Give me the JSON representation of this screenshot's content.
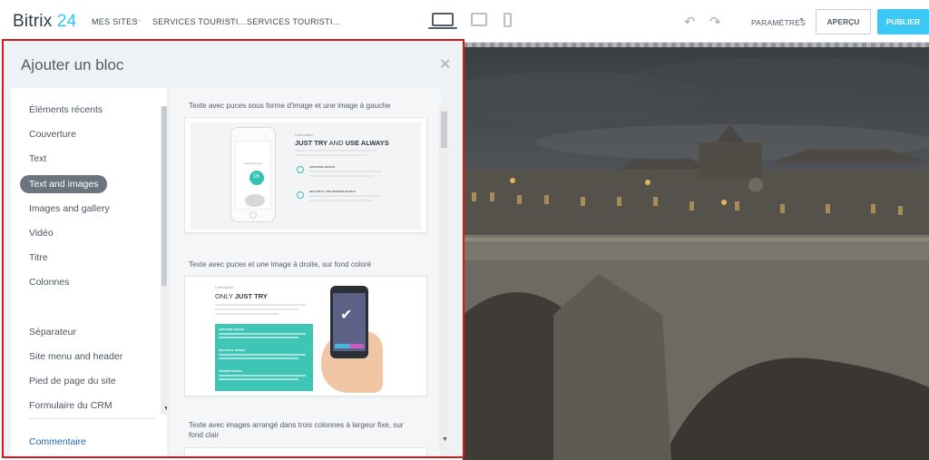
{
  "header": {
    "logo_text": "Bitrix",
    "logo_number": "24",
    "breadcrumbs": [
      {
        "label": "MES SITES"
      },
      {
        "label": "SERVICES TOURISTI..."
      },
      {
        "label": "SERVICES TOURISTI..."
      }
    ],
    "devices": [
      "desktop-icon",
      "tablet-icon",
      "mobile-icon"
    ],
    "settings_label": "PARAMÈTRES",
    "preview_label": "APERÇU",
    "publish_label": "PUBLIER",
    "accent_color": "#3bc8f5"
  },
  "panel": {
    "title": "Ajouter un bloc",
    "categories": [
      {
        "label": "Éléments récents"
      },
      {
        "label": "Couverture"
      },
      {
        "label": "Text"
      },
      {
        "label": "Text and images",
        "active": true
      },
      {
        "label": "Images and gallery"
      },
      {
        "label": "Vidéo"
      },
      {
        "label": "Titre"
      },
      {
        "label": "Colonnes"
      },
      {
        "label": "Séparateur"
      },
      {
        "label": "Site menu and header"
      },
      {
        "label": "Pied de page du site"
      },
      {
        "label": "Formulaire du CRM"
      }
    ],
    "comment_label": "Commentaire",
    "blocks": [
      {
        "title": "Texte avec puces sous forme d'image et une image à gauche",
        "preview": {
          "kicker": "Lorem ipsum",
          "heading_pre": "JUST TRY",
          "heading_mid": " AND ",
          "heading_post": "USE ALWAYS",
          "phone_greeting": "Good Morning!",
          "phone_number": "16",
          "features": [
            "AWESOME DESIGN",
            "BEAUTIFUL AND MODERN DESIGN"
          ]
        }
      },
      {
        "title": "Texte avec puces et une image à droite, sur fond coloré",
        "preview": {
          "kicker": "Lorem ipsum",
          "heading_pre": "ONLY ",
          "heading_post": "JUST TRY",
          "items": [
            "AWESOME DESIGN",
            "BEAUTIFUL DESIGN",
            "MODERN DESIGN"
          ]
        }
      },
      {
        "title": "Texte avec images arrangé dans trois colonnes à largeur fixe, sur fond clair"
      }
    ]
  }
}
